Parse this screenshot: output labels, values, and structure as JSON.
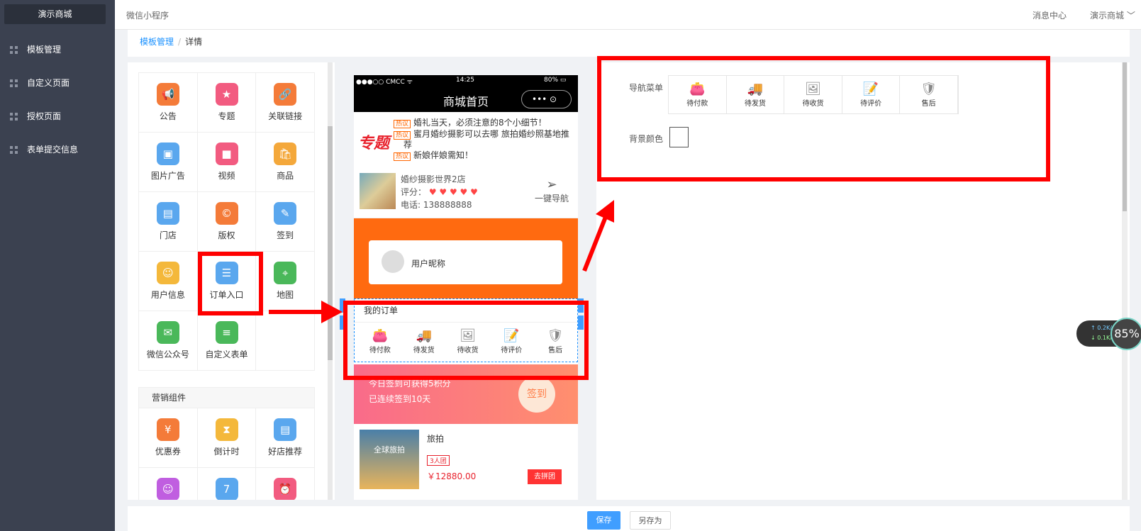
{
  "sidebar": {
    "logo": "演示商城",
    "items": [
      {
        "label": "模板管理"
      },
      {
        "label": "自定义页面"
      },
      {
        "label": "授权页面"
      },
      {
        "label": "表单提交信息"
      }
    ]
  },
  "topbar": {
    "app_name": "微信小程序",
    "message_center": "消息中心",
    "shop_name": "演示商城 ﹀"
  },
  "breadcrumb": {
    "parent": "模板管理",
    "separator": "/",
    "current": "详情"
  },
  "components": {
    "rows": [
      [
        {
          "label": "公告",
          "icon": "📢",
          "color": "#f47b39"
        },
        {
          "label": "专题",
          "icon": "★",
          "color": "#f25b80"
        },
        {
          "label": "关联链接",
          "icon": "🔗",
          "color": "#f47b39"
        }
      ],
      [
        {
          "label": "图片广告",
          "icon": "▣",
          "color": "#5aa7ee"
        },
        {
          "label": "视频",
          "icon": "■",
          "color": "#f25b80"
        },
        {
          "label": "商品",
          "icon": "🛍",
          "color": "#f4a83b"
        }
      ],
      [
        {
          "label": "门店",
          "icon": "▤",
          "color": "#5aa7ee"
        },
        {
          "label": "版权",
          "icon": "©",
          "color": "#f47b39"
        },
        {
          "label": "签到",
          "icon": "✎",
          "color": "#5aa7ee"
        }
      ],
      [
        {
          "label": "用户信息",
          "icon": "☺",
          "color": "#f4b83b"
        },
        {
          "label": "订单入口",
          "icon": "☰",
          "color": "#5aa7ee"
        },
        {
          "label": "地图",
          "icon": "⌖",
          "color": "#4ab85a"
        }
      ],
      [
        {
          "label": "微信公众号",
          "icon": "✉",
          "color": "#4ab85a"
        },
        {
          "label": "自定义表单",
          "icon": "≡",
          "color": "#4ab85a"
        },
        {
          "label": "",
          "icon": "",
          "color": "#fff"
        }
      ]
    ],
    "marketing_title": "营销组件",
    "marketing_rows": [
      [
        {
          "label": "优惠券",
          "icon": "¥",
          "color": "#f47b39"
        },
        {
          "label": "倒计时",
          "icon": "⧗",
          "color": "#f4b83b"
        },
        {
          "label": "好店推荐",
          "icon": "▤",
          "color": "#5aa7ee"
        }
      ],
      [
        {
          "label": "",
          "icon": "☺",
          "color": "#c05ee0"
        },
        {
          "label": "",
          "icon": "7",
          "color": "#5aa7ee"
        },
        {
          "label": "",
          "icon": "⏰",
          "color": "#f25b80"
        }
      ]
    ]
  },
  "phone": {
    "carrier": "●●●○○ CMCC ᯤ",
    "time": "14:25",
    "battery": "80% ▭",
    "title": "商城首页",
    "capsule": "•••  ⊙",
    "topic_label": "专题",
    "hot_tag": "热议",
    "topics": [
      "婚礼当天，必须注意的8个小细节！",
      "蜜月婚纱摄影可以去哪 旅拍婚纱照基地推",
      "荐",
      "新娘伴娘需知！"
    ],
    "store_name": "婚纱摄影世界2店",
    "store_rating_label": "评分：",
    "store_rating": 5,
    "store_phone": "电话: 138888888",
    "nav_label": "一键导航",
    "nav_icon": "send-icon",
    "user_nickname": "用户昵称",
    "orders_title": "我的订单",
    "order_items": [
      {
        "label": "待付款",
        "icon": "👛"
      },
      {
        "label": "待发货",
        "icon": "🚚"
      },
      {
        "label": "待收货",
        "icon": "🖼"
      },
      {
        "label": "待评价",
        "icon": "📝"
      },
      {
        "label": "售后",
        "icon": "🛡"
      }
    ],
    "signin_text1": "今日签到可获得5积分",
    "signin_text2": "已连续签到10天",
    "signin_button": "签到",
    "product_image_text": "全球旅拍",
    "product_title": "旅拍",
    "product_tag": "3人团",
    "product_price": "￥12880.00",
    "group_button": "去拼团"
  },
  "settings": {
    "nav_menu_label": "导航菜单",
    "nav_items": [
      {
        "label": "待付款",
        "icon": "👛"
      },
      {
        "label": "待发货",
        "icon": "🚚"
      },
      {
        "label": "待收货",
        "icon": "🖼"
      },
      {
        "label": "待评价",
        "icon": "📝"
      },
      {
        "label": "售后",
        "icon": "🛡"
      }
    ],
    "bg_color_label": "背景颜色",
    "bg_color": "#ffffff"
  },
  "footer": {
    "save": "保存",
    "save_as": "另存为"
  },
  "net_widget": {
    "up": "↑ 0.2K/s",
    "down": "↓ 0.1K/s",
    "percent": "85%"
  }
}
